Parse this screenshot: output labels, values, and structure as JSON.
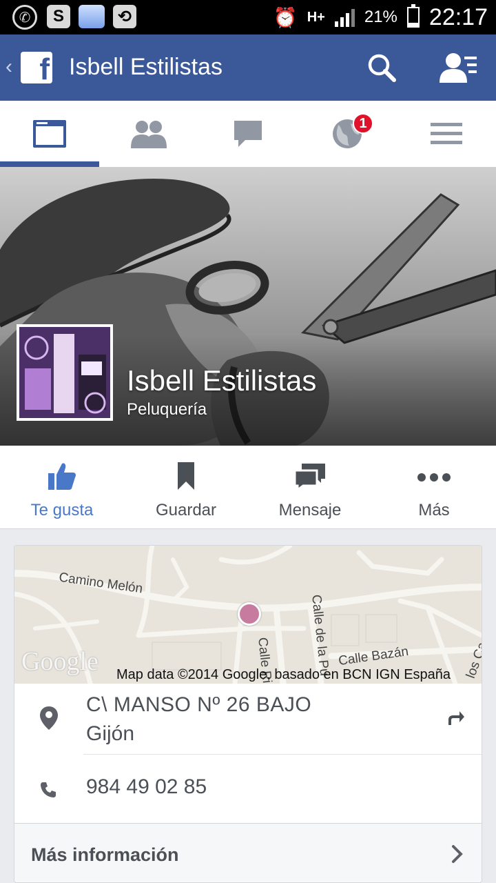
{
  "status_bar": {
    "battery": "21%",
    "network": "H+",
    "time": "22:17"
  },
  "header": {
    "title": "Isbell Estilistas",
    "logo_letter": "f"
  },
  "tabs": [
    {
      "name": "page",
      "active": true
    },
    {
      "name": "friends",
      "active": false
    },
    {
      "name": "messages",
      "active": false
    },
    {
      "name": "notifications",
      "badge": "1"
    },
    {
      "name": "menu",
      "active": false
    }
  ],
  "cover": {
    "name": "Isbell Estilistas",
    "category": "Peluquería"
  },
  "actions": [
    {
      "label": "Te gusta",
      "icon": "thumbs-up-icon",
      "active": true
    },
    {
      "label": "Guardar",
      "icon": "bookmark-icon"
    },
    {
      "label": "Mensaje",
      "icon": "message-icon"
    },
    {
      "label": "Más",
      "icon": "more-icon"
    }
  ],
  "map": {
    "logo": "Google",
    "credit": "Map data ©2014 Google, basado en BCN IGN España",
    "streets": [
      "Camino Melón",
      "Calle Rioja",
      "Calle de la Pu",
      "Calle Bazán",
      "los Ca"
    ]
  },
  "info": {
    "address_line1": "C\\ MANSO Nº 26 BAJO",
    "address_line2": "Gijón",
    "phone": "984 49 02 85",
    "more_info": "Más información"
  },
  "colors": {
    "brand": "#3b5998",
    "active_action": "#4a78c8",
    "badge": "#e0112b"
  }
}
